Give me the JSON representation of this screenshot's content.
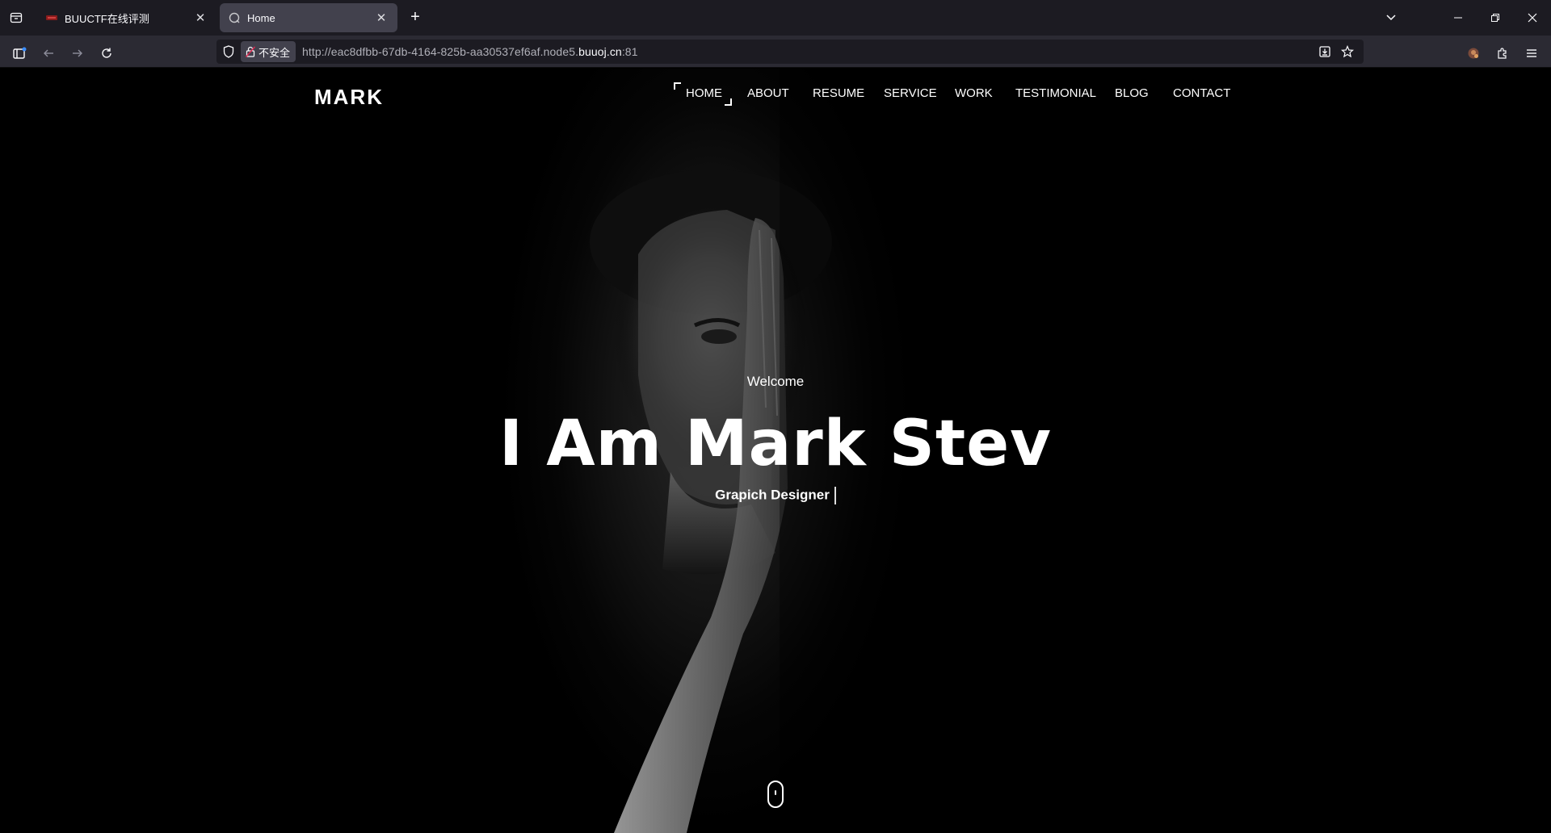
{
  "browser": {
    "tabs": [
      {
        "title": "BUUCTF在线评测",
        "active": false,
        "favicon": "buuctf-favicon"
      },
      {
        "title": "Home",
        "active": true,
        "favicon": "globe-favicon"
      }
    ],
    "url": {
      "insecure_label": "不安全",
      "prefix": "http://eac8dfbb-67db-4164-825b-aa30537ef6af.node5.",
      "domain": "buuoj.cn",
      "suffix": ":81"
    }
  },
  "site": {
    "logo": "MARK",
    "menu": [
      "HOME",
      "ABOUT",
      "RESUME",
      "SERVICE",
      "WORK",
      "TESTIMONIAL",
      "BLOG",
      "CONTACT"
    ],
    "active_menu": "HOME",
    "hero": {
      "welcome": "Welcome",
      "title": "I Am Mark Stev",
      "role": "Grapich Designer"
    }
  },
  "colors": {
    "chrome_tabstrip": "#1c1b22",
    "chrome_toolbar": "#2b2a33",
    "active_tab": "#42414d",
    "page_bg": "#000000",
    "text": "#ffffff"
  }
}
